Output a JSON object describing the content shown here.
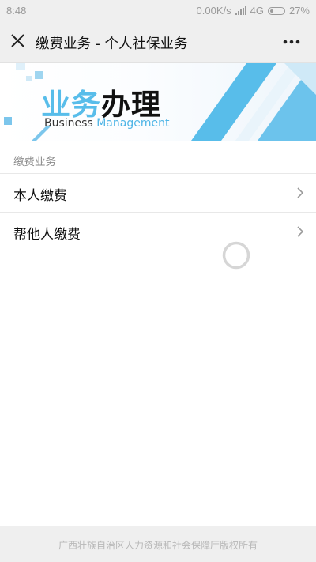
{
  "status_bar": {
    "time": "8:48",
    "network_speed": "0.00K/s",
    "network_type": "4G",
    "battery_percent": "27%",
    "battery_level": 0.27
  },
  "title_bar": {
    "title": "缴费业务 - 个人社保业务",
    "close_icon": "close-icon",
    "more_icon": "more-dots-icon"
  },
  "banner": {
    "title_part1": "业务",
    "title_part2": "办理",
    "subtitle_part1": "Business",
    "subtitle_part2": "Management",
    "accent_color": "#58bdea"
  },
  "section": {
    "title": "缴费业务",
    "items": [
      {
        "label": "本人缴费",
        "icon": "chevron-right-icon"
      },
      {
        "label": "帮他人缴费",
        "icon": "chevron-right-icon"
      }
    ]
  },
  "loading_indicator": "loading-spinner-icon",
  "footer": {
    "text": "广西壮族自治区人力资源和社会保障厅版权所有"
  }
}
